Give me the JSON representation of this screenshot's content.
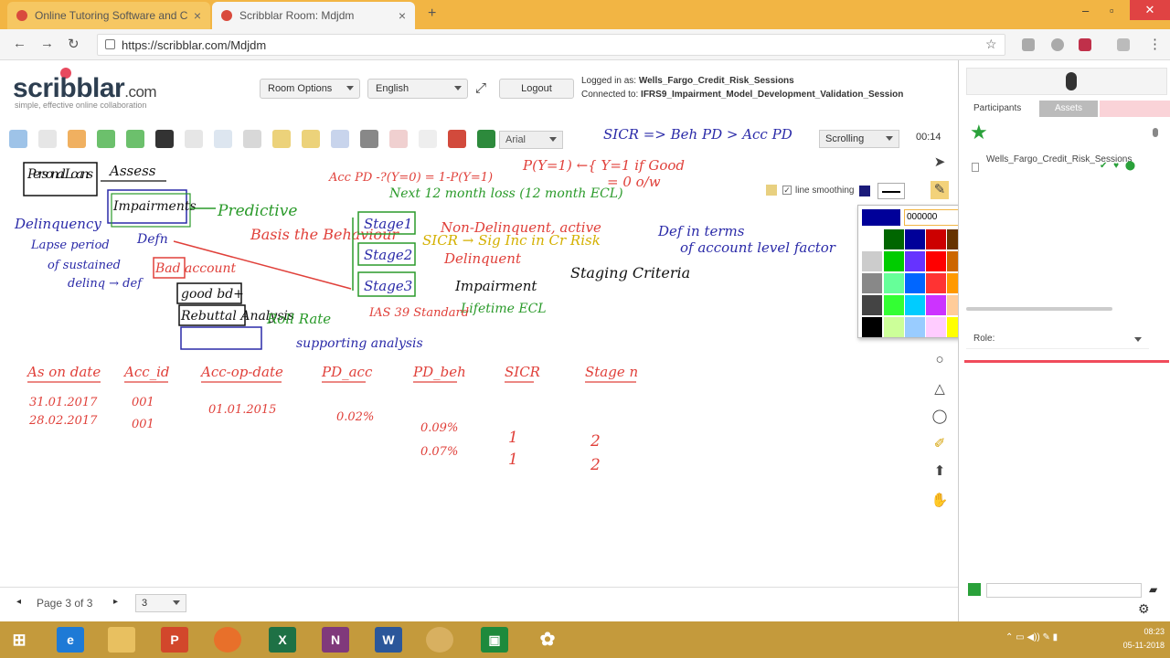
{
  "browser": {
    "tabs": [
      {
        "label": "Online Tutoring Software and C",
        "active": false
      },
      {
        "label": "Scribblar Room: Mdjdm",
        "active": true
      }
    ],
    "url": "https://scribblar.com/Mdjdm"
  },
  "header": {
    "logo_text": "scribblar",
    "logo_suffix": ".com",
    "tagline": "simple, effective online collaboration",
    "room_options_label": "Room Options",
    "language_label": "English",
    "logout_label": "Logout",
    "logged_in_prefix": "Logged in as:",
    "logged_in_user": "Wells_Fargo_Credit_Risk_Sessions",
    "connected_prefix": "Connected to:",
    "connected_room": "IFRS9_Impairment_Model_Development_Validation_Session"
  },
  "toolbar": {
    "font_select": "Arial",
    "scroll_select": "Scrolling",
    "timer": "00:14",
    "line_smoothing_label": "line smoothing"
  },
  "color_picker": {
    "hex_value": "000000",
    "current_color": "#000099",
    "swatches": [
      [
        "#006600",
        "#000099",
        "#cc0000",
        "#663300"
      ],
      [
        "#00cc00",
        "#6633ff",
        "#ff0000",
        "#cc6600"
      ],
      [
        "#66ff99",
        "#0066ff",
        "#ff3333",
        "#ff9900"
      ],
      [
        "#33ff33",
        "#00ccff",
        "#cc33ff",
        "#ffcc99"
      ],
      [
        "#ccff99",
        "#99ccff",
        "#ffccff",
        "#ffff00"
      ]
    ],
    "greys": [
      "#cccccc",
      "#888888",
      "#444444",
      "#000000"
    ]
  },
  "whiteboard": {
    "top_formula": "SICR => Beh PD > Acc PD",
    "probability_note": "Acc PD -?(Y=0) = 1-P(Y=1)",
    "py1": "P(Y=1) ←{ Y=1 if Good",
    "py0": "= 0 o/w",
    "personal_loans": "Personal Loans",
    "assess": "Assess",
    "impairments": "Impairments",
    "predictive": "Predictive",
    "basis_behaviour": "Basis the Behaviour",
    "delinquency": "Delinquency",
    "lapse": "Lapse period",
    "sustained": "of sustained",
    "delinq_def": "delinq → def",
    "defn": "Defn",
    "bad_account": "Bad account",
    "good_bad": "good bd+",
    "rebuttal": "Rebuttal Analysis",
    "roll_rate": "Roll Rate",
    "supporting": "supporting analysis",
    "next_12": "Next 12 month loss (12 month ECL)",
    "stage1": "Stage1",
    "stage2": "Stage2",
    "stage3": "Stage3",
    "non_delinquent": "Non-Delinquent, active",
    "sicr_inc": "SICR → Sig Inc in Cr Risk",
    "delinquent": "Delinquent",
    "impairment": "Impairment",
    "lifetime": "Lifetime ECL",
    "ias39": "IAS 39 Standard",
    "def_terms": "Def in terms",
    "account_level": "of account level factor",
    "staging": "Staging Criteria",
    "table_headers": [
      "As on date",
      "Acc_id",
      "Acc-op-date",
      "PD_acc",
      "PD_beh",
      "SICR",
      "Stage n"
    ],
    "row1": [
      "31.01.2017",
      "001",
      "01.01.2015",
      "0.02%",
      "0.09%",
      "1",
      "2"
    ],
    "row2": [
      "28.02.2017",
      "001",
      "",
      "",
      "0.07%",
      "1",
      "2"
    ]
  },
  "pagebar": {
    "page_label": "Page 3 of 3",
    "page_select": "3"
  },
  "right_panel": {
    "tab_participants": "Participants",
    "tab_attach": "Assets",
    "participant_name": "Wells_Fargo_Credit_Risk_Sessions",
    "role_label": "Role:"
  },
  "taskbar": {
    "time": "08:23",
    "date": "05-11-2018"
  },
  "colors": {
    "tabbar": "#f2b544",
    "accent_red": "#e84a5f",
    "ink_red": "#e0403a",
    "ink_blue": "#2a2aa8",
    "ink_green": "#2a9a2a",
    "ink_black": "#111111"
  }
}
